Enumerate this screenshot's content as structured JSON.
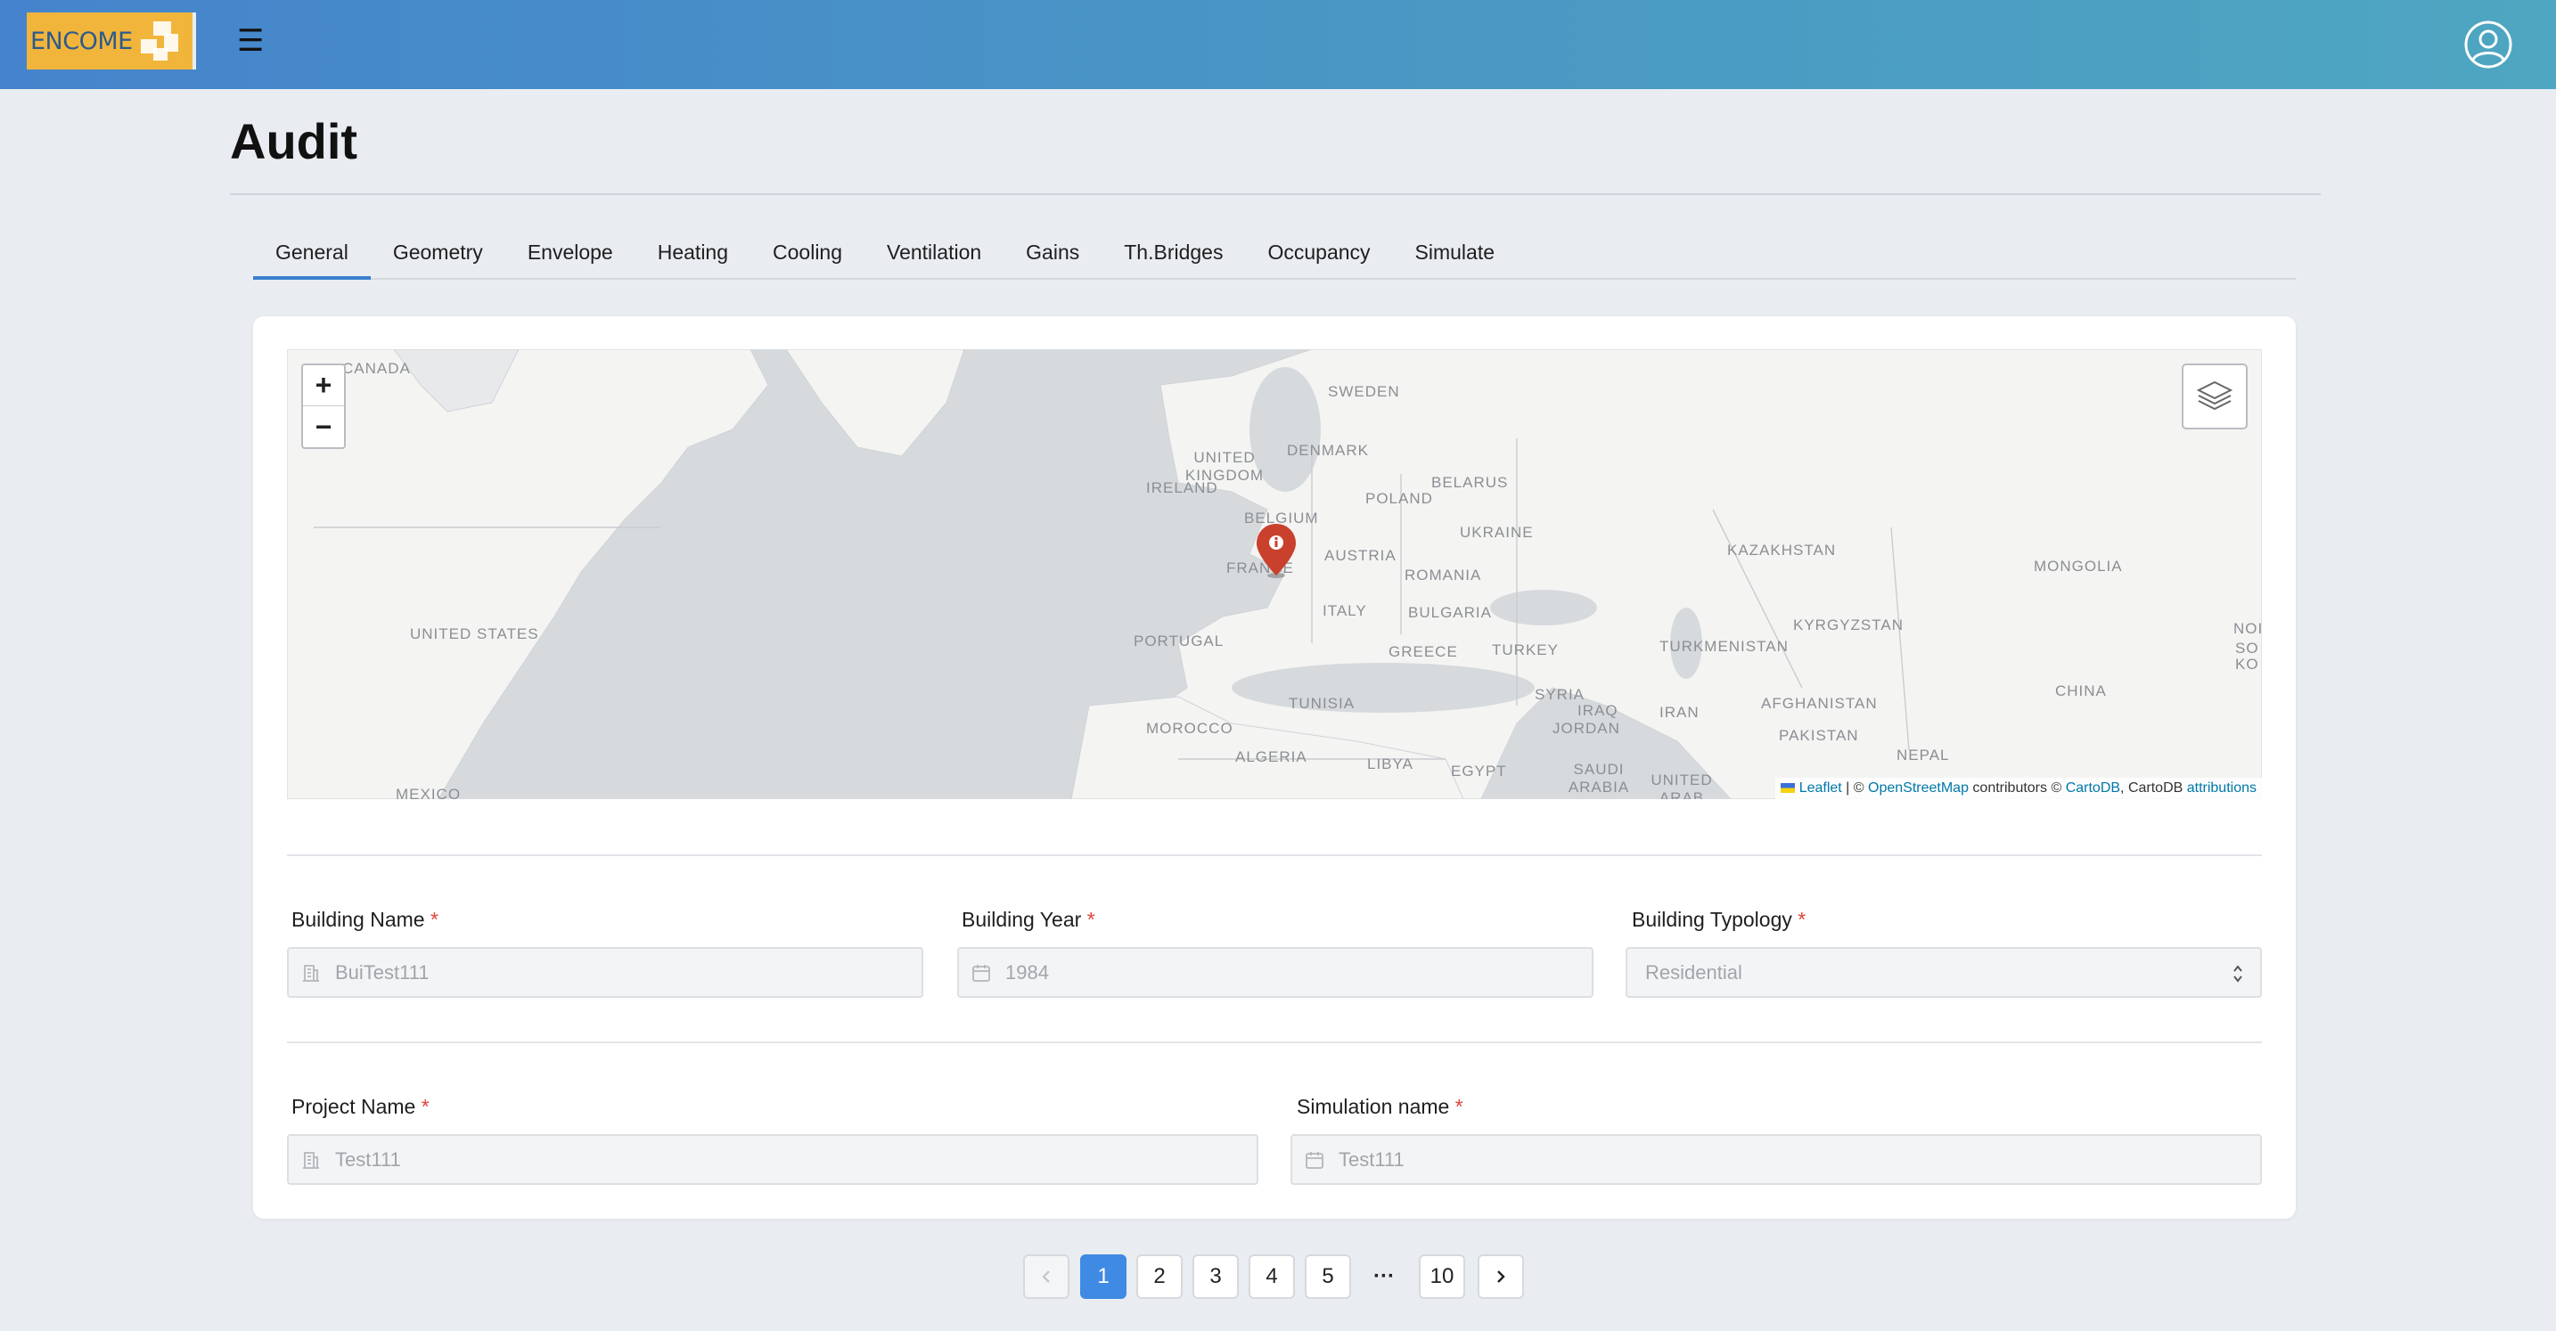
{
  "header": {
    "logo_text": "ENCOME",
    "menu_icon": "hamburger-icon",
    "user_icon": "user-circle-icon",
    "gradient_colors": [
      "#4584cc",
      "#4ea6c1"
    ]
  },
  "page": {
    "title": "Audit"
  },
  "tabs": [
    {
      "label": "General",
      "active": true
    },
    {
      "label": "Geometry"
    },
    {
      "label": "Envelope"
    },
    {
      "label": "Heating"
    },
    {
      "label": "Cooling"
    },
    {
      "label": "Ventilation"
    },
    {
      "label": "Gains"
    },
    {
      "label": "Th.Bridges"
    },
    {
      "label": "Occupancy"
    },
    {
      "label": "Simulate"
    }
  ],
  "map": {
    "zoom_in": "+",
    "zoom_out": "−",
    "layers_icon": "layers-icon",
    "marker_icon": "map-marker-icon",
    "countries": [
      "CANADA",
      "UNITED STATES",
      "MEXICO",
      "SWEDEN",
      "UNITED KINGDOM",
      "IRELAND",
      "DENMARK",
      "BELARUS",
      "POLAND",
      "BELGIUM",
      "UKRAINE",
      "FRANCE",
      "AUSTRIA",
      "ROMANIA",
      "KAZAKHSTAN",
      "MONGOLIA",
      "ITALY",
      "BULGARIA",
      "KYRGYZSTAN",
      "PORTUGAL",
      "GREECE",
      "TURKEY",
      "TURKMENISTAN",
      "TUNISIA",
      "SYRIA",
      "IRAQ",
      "IRAN",
      "AFGHANISTAN",
      "CHINA",
      "MOROCCO",
      "JORDAN",
      "PAKISTAN",
      "ALGERIA",
      "LIBYA",
      "EGYPT",
      "SAUDI ARABIA",
      "UNITED ARAB",
      "NEPAL",
      "NOI",
      "KO",
      "SO"
    ],
    "attribution": {
      "leaflet": "Leaflet",
      "sep1": " | © ",
      "osm": "OpenStreetMap",
      "sep2": " contributors © ",
      "carto": "CartoDB",
      "sep3": ", CartoDB ",
      "attributions": "attributions"
    }
  },
  "form": {
    "building_name": {
      "label": "Building Name",
      "value": "BuiTest111",
      "icon": "building-icon"
    },
    "building_year": {
      "label": "Building Year",
      "value": "1984",
      "icon": "calendar-icon"
    },
    "building_typology": {
      "label": "Building Typology",
      "value": "Residential",
      "icon": "chevron-updown-icon"
    },
    "project_name": {
      "label": "Project Name",
      "value": "Test111",
      "icon": "building-icon"
    },
    "simulation_name": {
      "label": "Simulation name",
      "value": "Test111",
      "icon": "calendar-icon"
    },
    "required_mark": "*"
  },
  "pagination": {
    "prev_icon": "chevron-left-icon",
    "next_icon": "chevron-right-icon",
    "pages": [
      "1",
      "2",
      "3",
      "4",
      "5"
    ],
    "ellipsis": "···",
    "last": "10",
    "current": "1"
  }
}
